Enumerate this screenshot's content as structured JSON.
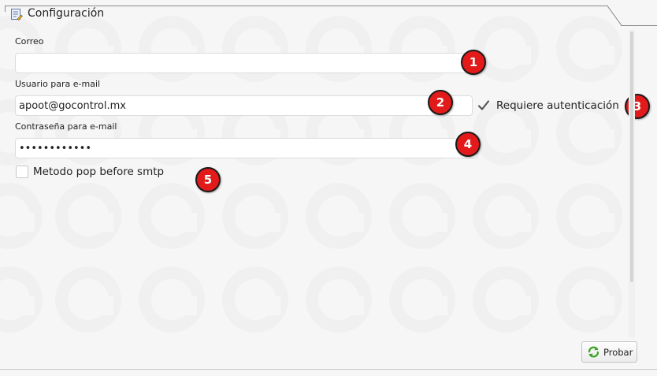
{
  "panel": {
    "title": "Configuración",
    "title_icon": "settings-form-icon"
  },
  "fields": {
    "correo": {
      "label": "Correo",
      "value": "",
      "badge": "1"
    },
    "usuario": {
      "label": "Usuario para e-mail",
      "value": "apoot@gocontrol.mx",
      "badge": "2"
    },
    "contrasena": {
      "label": "Contraseña para e-mail",
      "value": "••••••••••••",
      "badge": "4"
    }
  },
  "options": {
    "requiere_autenticacion": {
      "label": "Requiere autenticación",
      "checked": true,
      "badge": "3"
    },
    "pop_before_smtp": {
      "label": "Metodo pop before smtp",
      "checked": false,
      "badge": "5"
    }
  },
  "actions": {
    "probar_label": "Probar",
    "probar_icon": "refresh-icon"
  },
  "colors": {
    "badge": "#e21a1a",
    "panel_bg": "#f6f6f6",
    "check_mark": "#555555",
    "refresh_icon": "#3fa52a"
  }
}
